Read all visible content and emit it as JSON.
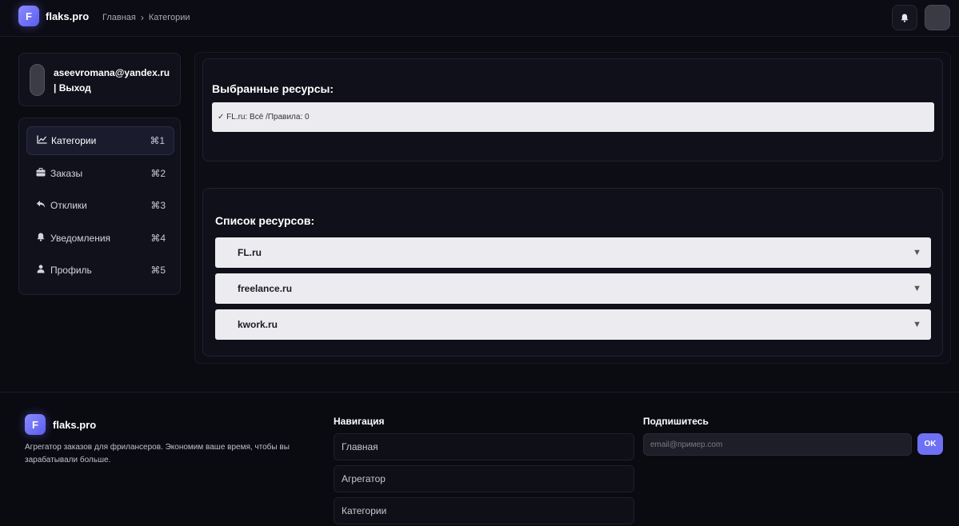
{
  "header": {
    "logo_letter": "F",
    "brand": "flaks.pro",
    "breadcrumb": [
      "Главная",
      "Категории"
    ]
  },
  "user": {
    "email": "aseevromana@yandex.ru",
    "logout": "| Выход"
  },
  "sidebar": {
    "items": [
      {
        "label": "Категории",
        "shortcut": "⌘1",
        "icon": "chart-line-icon",
        "active": true
      },
      {
        "label": "Заказы",
        "shortcut": "⌘2",
        "icon": "briefcase-icon",
        "active": false
      },
      {
        "label": "Отклики",
        "shortcut": "⌘3",
        "icon": "reply-icon",
        "active": false
      },
      {
        "label": "Уведомления",
        "shortcut": "⌘4",
        "icon": "bell-icon",
        "active": false
      },
      {
        "label": "Профиль",
        "shortcut": "⌘5",
        "icon": "user-icon",
        "active": false
      }
    ]
  },
  "main": {
    "selected_title": "Выбранные ресурсы:",
    "selected_text": "✓ FL.ru: Всё /Правила: 0",
    "list_title": "Список ресурсов:",
    "resources": [
      "FL.ru",
      "freelance.ru",
      "kwork.ru"
    ]
  },
  "footer": {
    "logo_letter": "F",
    "brand": "flaks.pro",
    "description": "Агрегатор заказов для фрилансеров. Экономим ваше время, чтобы вы зарабатывали больше.",
    "nav_heading": "Навигация",
    "nav_items": [
      "Главная",
      "Агрегатор",
      "Категории"
    ],
    "subscribe_heading": "Подпишитесь",
    "email_placeholder": "email@пример.com",
    "ok_label": "OK"
  },
  "colors": {
    "background": "#0b0b12",
    "accent": "#6e70f5",
    "card": "#11111c",
    "light_row": "#ececf0"
  }
}
